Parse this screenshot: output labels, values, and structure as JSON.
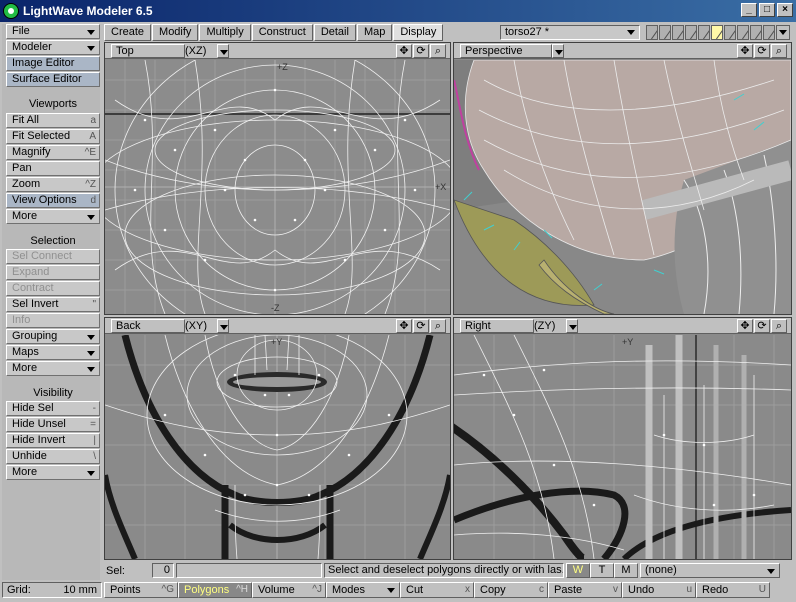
{
  "window": {
    "title": "LightWave Modeler 6.5",
    "buttons": [
      "_",
      "□",
      "×"
    ]
  },
  "left_toolbar": {
    "top_items": [
      {
        "label": "File",
        "dropdown": true
      },
      {
        "label": "Modeler",
        "dropdown": true
      },
      {
        "label": "Image Editor"
      },
      {
        "label": "Surface Editor"
      }
    ],
    "viewports_header": "Viewports",
    "viewport_items": [
      {
        "label": "Fit All",
        "shortcut": "a"
      },
      {
        "label": "Fit Selected",
        "shortcut": "A"
      },
      {
        "label": "Magnify",
        "shortcut": "^E"
      },
      {
        "label": "Pan",
        "shortcut": ""
      },
      {
        "label": "Zoom",
        "shortcut": "^Z"
      },
      {
        "label": "View Options",
        "shortcut": "d"
      },
      {
        "label": "More",
        "dropdown": true
      }
    ],
    "selection_header": "Selection",
    "selection_items": [
      {
        "label": "Sel Connect",
        "shortcut": "",
        "dim": true
      },
      {
        "label": "Expand",
        "shortcut": "",
        "dim": true
      },
      {
        "label": "Contract",
        "shortcut": "",
        "dim": true
      },
      {
        "label": "Sel Invert",
        "shortcut": "\""
      },
      {
        "label": "Info",
        "shortcut": "",
        "dim": true
      },
      {
        "label": "Grouping",
        "dropdown": true
      },
      {
        "label": "Maps",
        "dropdown": true
      },
      {
        "label": "More",
        "dropdown": true
      }
    ],
    "visibility_header": "Visibility",
    "visibility_items": [
      {
        "label": "Hide Sel",
        "shortcut": "-"
      },
      {
        "label": "Hide Unsel",
        "shortcut": "="
      },
      {
        "label": "Hide Invert",
        "shortcut": "|"
      },
      {
        "label": "Unhide",
        "shortcut": "\\"
      },
      {
        "label": "More",
        "dropdown": true
      }
    ]
  },
  "tabs": [
    "Create",
    "Modify",
    "Multiply",
    "Construct",
    "Detail",
    "Map",
    "Display"
  ],
  "active_tab": "Display",
  "object_selector": "torso27 *",
  "viewports": [
    {
      "name": "Top",
      "axes": "(XZ)"
    },
    {
      "name": "Perspective",
      "axes": ""
    },
    {
      "name": "Back",
      "axes": "(XY)"
    },
    {
      "name": "Right",
      "axes": "(ZY)"
    }
  ],
  "viewport_tool_icons": [
    "move-icon",
    "rotate-icon",
    "zoom-icon"
  ],
  "axis_labels": {
    "top": [
      "+Z",
      "+X",
      "-Z"
    ],
    "back": [
      "+Y"
    ],
    "right": [
      "+Y"
    ]
  },
  "status": {
    "sel_label": "Sel:",
    "sel_value": "0",
    "message": "Select and deselect polygons directly or with las...",
    "wtm": [
      "W",
      "T",
      "M"
    ],
    "active_wtm": "W",
    "vmap": "(none)"
  },
  "commands": {
    "grid_label": "Grid:",
    "grid_value": "10 mm",
    "modes": [
      {
        "label": "Points",
        "shortcut": "^G"
      },
      {
        "label": "Polygons",
        "shortcut": "^H"
      },
      {
        "label": "Volume",
        "shortcut": "^J"
      }
    ],
    "active_mode": "Polygons",
    "modes_menu": "Modes",
    "edit": [
      {
        "label": "Cut",
        "shortcut": "x"
      },
      {
        "label": "Copy",
        "shortcut": "c"
      },
      {
        "label": "Paste",
        "shortcut": "v"
      },
      {
        "label": "Undo",
        "shortcut": "u"
      },
      {
        "label": "Redo",
        "shortcut": "U"
      }
    ]
  }
}
